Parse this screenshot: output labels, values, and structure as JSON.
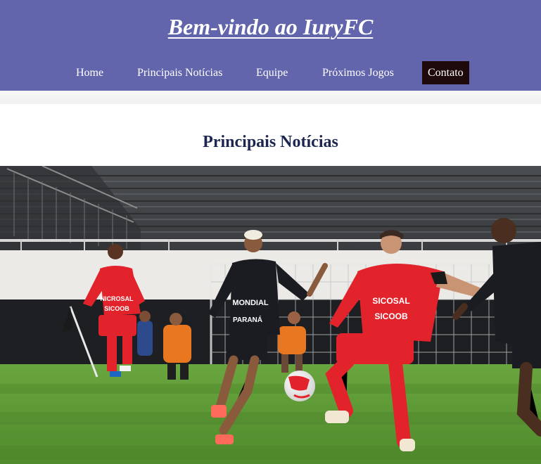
{
  "header": {
    "title": "Bem-vindo ao IuryFC",
    "background": "#6265ab"
  },
  "nav": {
    "items": [
      {
        "label": "Home"
      },
      {
        "label": "Principais Notícias"
      },
      {
        "label": "Equipe"
      },
      {
        "label": "Próximos Jogos"
      },
      {
        "label": "Contato",
        "active": true
      }
    ],
    "active_background": "#1e0a0b"
  },
  "main": {
    "section_title": "Principais Notícias",
    "photo": {
      "jersey_texts": {
        "red_front": "SICOSAL",
        "red_front_2": "SICOOB",
        "dark_front": "MONDIAL",
        "dark_front_2": "PARANÁ",
        "red_left": "NICROSAL",
        "red_left_2": "SICOOB"
      },
      "colors": {
        "red_kit": "#e2232b",
        "dark_kit": "#1a1c22",
        "pitch": "#5f9a3a"
      }
    }
  }
}
